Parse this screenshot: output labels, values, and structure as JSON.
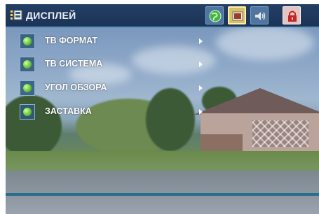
{
  "header": {
    "title": "ДИСПЛЕЙ",
    "title_icon": "display-settings-icon",
    "tabs": [
      {
        "name": "globe-icon",
        "active": false
      },
      {
        "name": "display-icon",
        "active": true
      },
      {
        "name": "speaker-icon",
        "active": false
      },
      {
        "name": "lock-icon",
        "active": false
      }
    ]
  },
  "menu": {
    "items": [
      {
        "label": "ТВ ФОРМАТ",
        "has_submenu": true
      },
      {
        "label": "ТВ СИСТЕМА",
        "has_submenu": true
      },
      {
        "label": "УГОЛ ОБЗОРА",
        "has_submenu": true
      },
      {
        "label": "ЗАСТАВКА",
        "has_submenu": true
      }
    ]
  },
  "colors": {
    "header_bg": "#1b3458",
    "active_tab": "#d7c06a",
    "bullet_green": "#7bd24a",
    "accent_line": "#2a6f8e"
  }
}
